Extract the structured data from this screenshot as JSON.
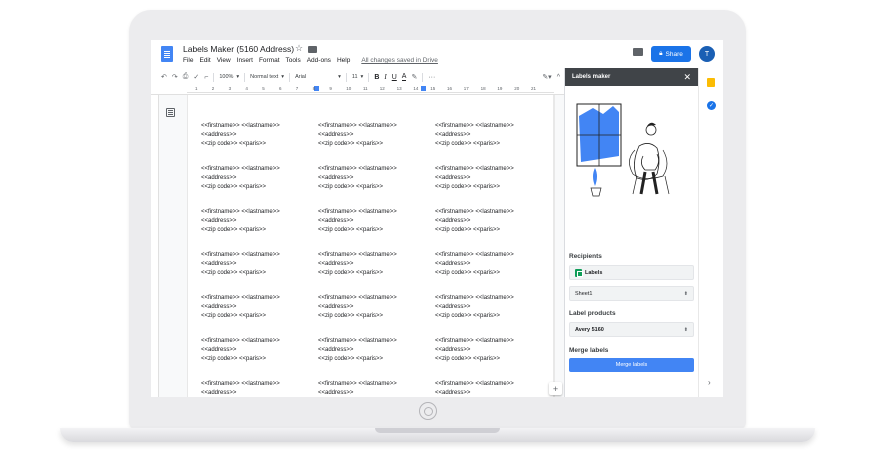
{
  "header": {
    "title": "Labels Maker (5160 Address)",
    "menu": [
      "File",
      "Edit",
      "View",
      "Insert",
      "Format",
      "Tools",
      "Add-ons",
      "Help"
    ],
    "saved_status": "All changes saved in Drive",
    "share_label": "Share",
    "avatar_initial": "T"
  },
  "toolbar": {
    "zoom": "100%",
    "style": "Normal text",
    "font": "Arial",
    "font_size": "11",
    "bold": "B",
    "italic": "I",
    "underline": "U",
    "text_color": "A",
    "more": "···"
  },
  "ruler": {
    "ticks": [
      "1",
      "2",
      "3",
      "4",
      "5",
      "6",
      "7",
      "8",
      "9",
      "10",
      "11",
      "12",
      "13",
      "14",
      "15",
      "16",
      "17",
      "18",
      "19",
      "20",
      "21"
    ]
  },
  "document": {
    "label": {
      "line1": "<<firstname>> <<lastname>>",
      "line2": "<<address>>",
      "line3": "<<zip code>> <<paris>>"
    }
  },
  "side_panel": {
    "title": "Labels maker",
    "recipients_heading": "Recipients",
    "recipients_source": "Labels",
    "sheet_value": "Sheet1",
    "label_products_heading": "Label products",
    "label_product_value": "Avery 5160",
    "merge_heading": "Merge labels",
    "merge_button": "Merge labels"
  },
  "colors": {
    "accent": "#1a73e8",
    "panel_header": "#404448",
    "merge_button": "#4285f4",
    "sheets_green": "#0f9d58",
    "keep_yellow": "#fbbc04"
  }
}
